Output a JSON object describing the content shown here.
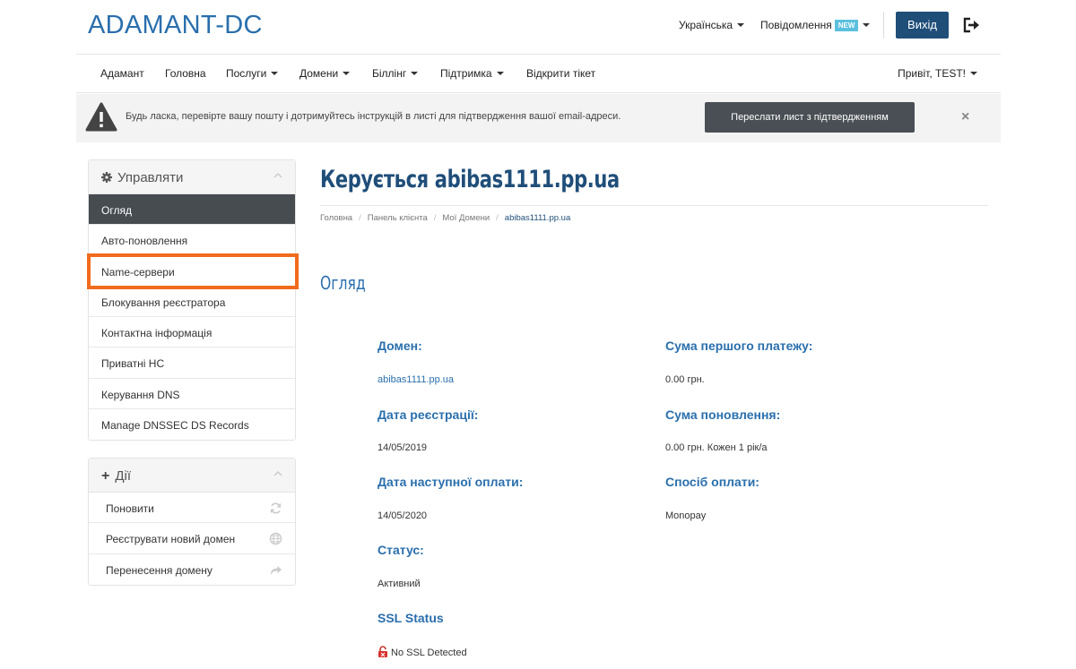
{
  "header": {
    "brand": "ADAMANT-DC",
    "language": "Українська",
    "notifications": "Повідомлення",
    "new_badge": "NEW",
    "logout_label": "Вихід"
  },
  "nav": {
    "items": [
      "Адамант",
      "Головна",
      "Послуги",
      "Домени",
      "Біллінг",
      "Підтримка",
      "Відкрити тікет"
    ],
    "greeting": "Привіт, TEST!"
  },
  "alert": {
    "text": "Будь ласка, перевірте вашу пошту і дотримуйтесь інструкцій в листі для підтвердження вашої email-адреси.",
    "button": "Переслати лист з підтвердженням",
    "close": "×"
  },
  "manage_panel": {
    "title": "Управляти",
    "items": [
      "Огляд",
      "Авто-поновлення",
      "Name-сервери",
      "Блокування реєстратора",
      "Контактна інформація",
      "Приватні НС",
      "Керування DNS",
      "Manage DNSSEC DS Records"
    ]
  },
  "actions_panel": {
    "title": "Дії",
    "items": [
      "Поновити",
      "Реєструвати новий домен",
      "Перенесення домену"
    ]
  },
  "main": {
    "title": "Керується abibas1111.pp.ua",
    "breadcrumb": [
      "Головна",
      "Панель клієнта",
      "Мої Домени",
      "abibas1111.pp.ua"
    ],
    "section": "Огляд",
    "domain_label": "Домен:",
    "domain_value": "abibas1111.pp.ua",
    "reg_date_label": "Дата реєстрації:",
    "reg_date_value": "14/05/2019",
    "next_due_label": "Дата наступної оплати:",
    "next_due_value": "14/05/2020",
    "status_label": "Статус:",
    "status_value": "Активний",
    "ssl_label": "SSL Status",
    "ssl_value": "No SSL Detected",
    "first_payment_label": "Сума першого платежу:",
    "first_payment_value": "0.00 грн.",
    "renewal_label": "Сума поновлення:",
    "renewal_value": "0.00 грн. Кожен 1 рік/а",
    "payment_method_label": "Спосіб оплати:",
    "payment_method_value": "Monopay"
  },
  "colors": {
    "brand": "#2a6fad",
    "dark_button": "#1f4e79",
    "highlight": "#f26b1d",
    "active_menu": "#474c51"
  }
}
